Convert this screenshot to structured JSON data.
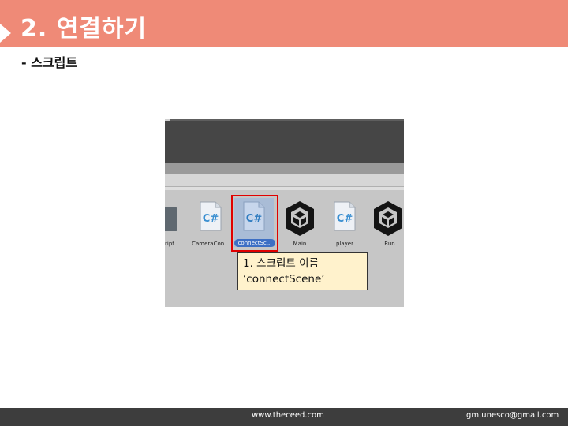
{
  "slide": {
    "title": "2. 연결하기",
    "subtitle": "- 스크립트"
  },
  "screenshot": {
    "assets": [
      {
        "label": "ript",
        "icon": "folder-icon"
      },
      {
        "label": "CameraCon...",
        "icon": "csharp-file-icon"
      },
      {
        "label": "connectSc...",
        "icon": "csharp-file-icon",
        "selected": true
      },
      {
        "label": "Main",
        "icon": "unity-scene-icon"
      },
      {
        "label": "player",
        "icon": "csharp-file-icon"
      },
      {
        "label": "Run",
        "icon": "unity-scene-icon"
      }
    ],
    "callout": {
      "line1": "1. 스크립트 이름",
      "line2": "‘connectScene’"
    },
    "highlight_color": "#e00000"
  },
  "footer": {
    "site": "www.theceed.com",
    "email": "gm.unesco@gmail.com"
  },
  "colors": {
    "title_bar": "#ef8a77",
    "footer_bar": "#3d3d3d",
    "callout_bg": "#fff2cc"
  }
}
